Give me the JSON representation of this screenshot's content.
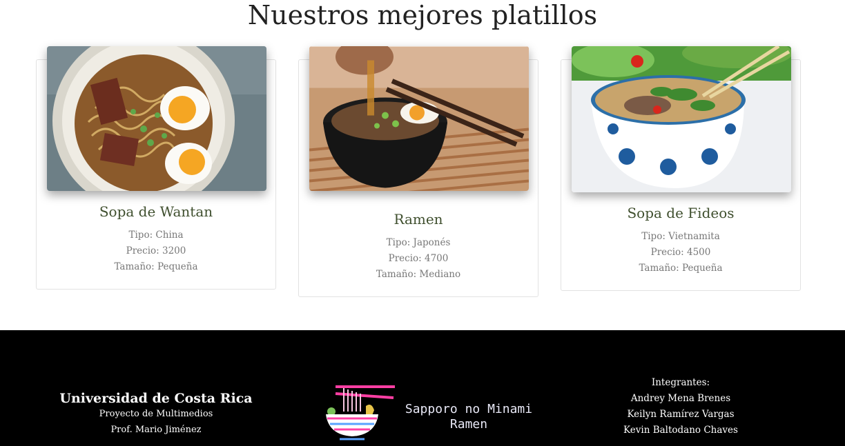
{
  "section": {
    "title": "Nuestros mejores platillos"
  },
  "cards": [
    {
      "title": "Sopa de Wantan",
      "tipo": "Tipo: China",
      "precio": "Precio: 3200",
      "tamano": "Tamaño: Pequeña",
      "image": "ramen-bowl-egg-photo"
    },
    {
      "title": "Ramen",
      "tipo": "Tipo: Japonés",
      "precio": "Precio: 4700",
      "tamano": "Tamaño: Mediano",
      "image": "ramen-pour-broth-photo"
    },
    {
      "title": "Sopa de Fideos",
      "tipo": "Tipo: Vietnamita",
      "precio": "Precio: 4500",
      "tamano": "Tamaño: Pequeña",
      "image": "pho-bowl-photo"
    }
  ],
  "footer": {
    "university": "Universidad de Costa Rica",
    "project": "Proyecto de Multimedios",
    "professor": "Prof. Mario Jiménez",
    "brand_line1": "Sapporo no Minami",
    "brand_line2": "Ramen",
    "members_heading": "Integrantes:",
    "members": [
      "Andrey Mena Brenes",
      "Keilyn Ramírez Vargas",
      "Kevin Baltodano Chaves"
    ]
  },
  "colors": {
    "card_title": "#3f4f2e",
    "footer_bg": "#000000",
    "logo_pink": "#ff3fa4",
    "logo_blue": "#5aa2ff"
  }
}
